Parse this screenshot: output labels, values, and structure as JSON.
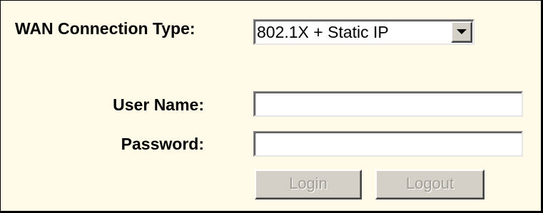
{
  "form": {
    "connection_type_label": "WAN Connection Type:",
    "connection_type_value": "802.1X + Static IP",
    "user_name_label": "User Name:",
    "user_name_value": "",
    "password_label": "Password:",
    "password_value": "",
    "login_label": "Login",
    "logout_label": "Logout"
  },
  "icons": {
    "dropdown": "chevron-down-icon"
  },
  "colors": {
    "panel_background": "#fffbe8",
    "button_face": "#d4d0c8",
    "disabled_text": "#a09c94"
  }
}
